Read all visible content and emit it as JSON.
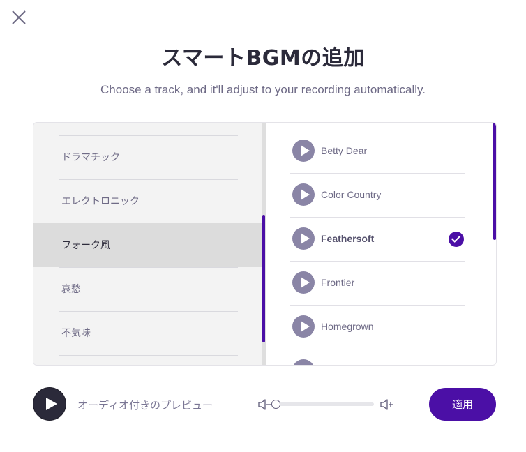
{
  "dialog": {
    "title": "スマートBGMの追加",
    "subtitle": "Choose a track, and it'll adjust to your recording automatically."
  },
  "categories": [
    {
      "label": "ドラマチック",
      "selected": false
    },
    {
      "label": "エレクトロニック",
      "selected": false
    },
    {
      "label": "フォーク風",
      "selected": true
    },
    {
      "label": "哀愁",
      "selected": false
    },
    {
      "label": "不気味",
      "selected": false
    }
  ],
  "tracks": [
    {
      "name": "Betty Dear",
      "selected": false
    },
    {
      "name": "Color Country",
      "selected": false
    },
    {
      "name": "Feathersoft",
      "selected": true
    },
    {
      "name": "Frontier",
      "selected": false
    },
    {
      "name": "Homegrown",
      "selected": false
    }
  ],
  "footer": {
    "preview_label": "オーディオ付きのプレビュー",
    "apply_label": "適用",
    "volume_level": 0
  },
  "colors": {
    "accent": "#4b0fa6",
    "play_icon": "#8a85a6",
    "dark_button": "#2b2a3a"
  }
}
